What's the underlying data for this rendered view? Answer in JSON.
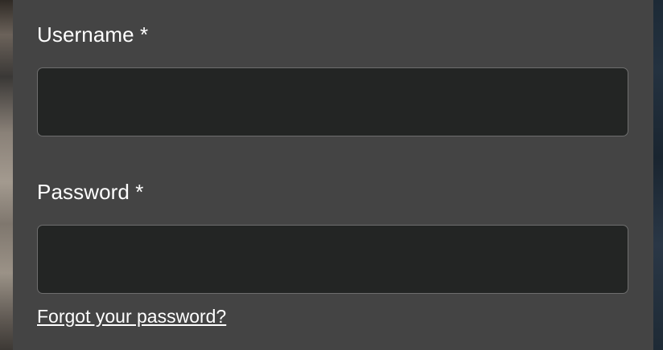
{
  "login_form": {
    "username": {
      "label": "Username *",
      "value": "",
      "placeholder": ""
    },
    "password": {
      "label": "Password *",
      "value": "",
      "placeholder": ""
    },
    "forgot_password_link": "Forgot your password?"
  },
  "colors": {
    "panel_background": "#444444",
    "input_background": "#232524",
    "input_border": "#6e6e6e",
    "text": "#ffffff"
  }
}
